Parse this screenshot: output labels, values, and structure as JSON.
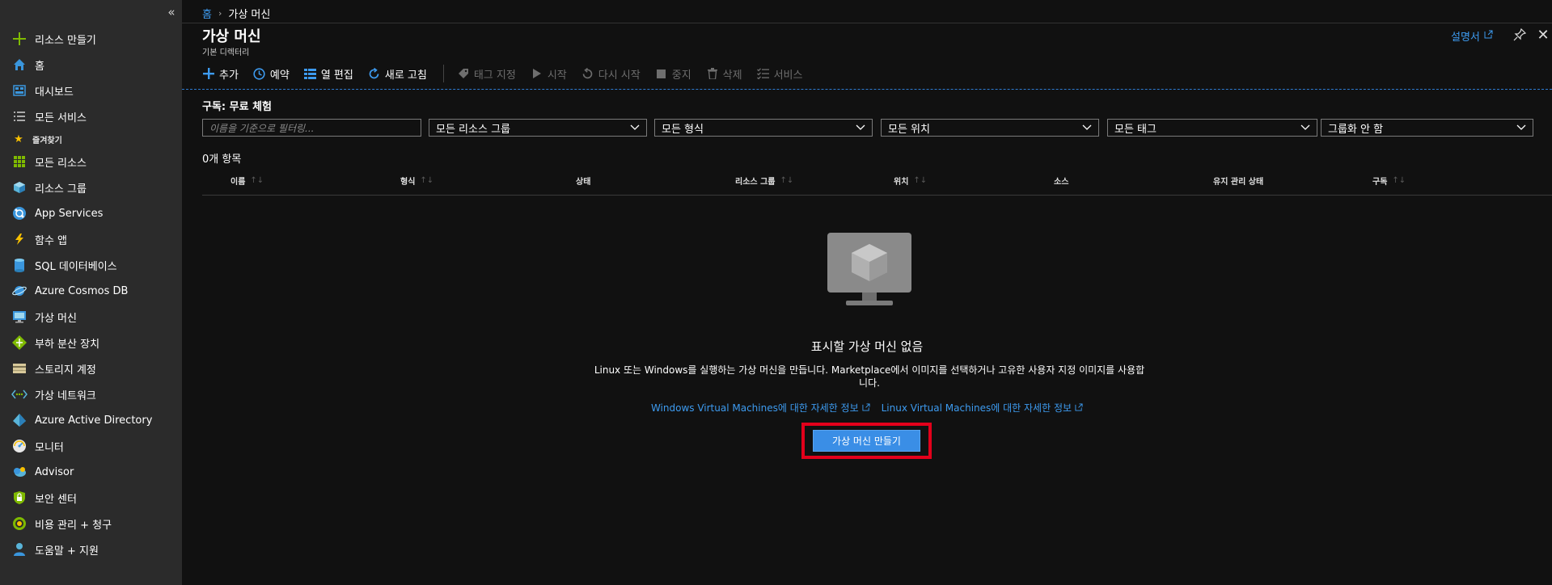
{
  "sidebar": {
    "create_resource": "리소스 만들기",
    "home": "홈",
    "dashboard": "대시보드",
    "all_services": "모든 서비스",
    "favorites": "즐겨찾기",
    "items": [
      {
        "label": "모든 리소스",
        "icon": "all-resources-icon"
      },
      {
        "label": "리소스 그룹",
        "icon": "resource-groups-icon"
      },
      {
        "label": "App Services",
        "icon": "app-services-icon"
      },
      {
        "label": "함수 앱",
        "icon": "function-app-icon"
      },
      {
        "label": "SQL 데이터베이스",
        "icon": "sql-database-icon"
      },
      {
        "label": "Azure Cosmos DB",
        "icon": "cosmos-db-icon"
      },
      {
        "label": "가상 머신",
        "icon": "virtual-machine-icon"
      },
      {
        "label": "부하 분산 장치",
        "icon": "load-balancer-icon"
      },
      {
        "label": "스토리지 계정",
        "icon": "storage-account-icon"
      },
      {
        "label": "가상 네트워크",
        "icon": "virtual-network-icon"
      },
      {
        "label": "Azure Active Directory",
        "icon": "active-directory-icon"
      },
      {
        "label": "모니터",
        "icon": "monitor-icon"
      },
      {
        "label": "Advisor",
        "icon": "advisor-icon"
      },
      {
        "label": "보안 센터",
        "icon": "security-center-icon"
      },
      {
        "label": "비용 관리 + 청구",
        "icon": "cost-management-icon"
      },
      {
        "label": "도움말 + 지원",
        "icon": "help-support-icon"
      }
    ]
  },
  "breadcrumb": {
    "home": "홈",
    "sep": "›",
    "current": "가상 머신"
  },
  "header": {
    "title": "가상 머신",
    "subtitle": "기본 디렉터리",
    "docs": "설명서"
  },
  "toolbar": {
    "add": "추가",
    "schedule": "예약",
    "edit_columns": "열 편집",
    "refresh": "새로 고침",
    "tags": "태그 지정",
    "start": "시작",
    "restart": "다시 시작",
    "stop": "중지",
    "delete": "삭제",
    "services": "서비스"
  },
  "subscription": "구독: 무료 체험",
  "filters": {
    "name_placeholder": "이름을 기준으로 필터링...",
    "resource_group": "모든 리소스 그룹",
    "type": "모든 형식",
    "location": "모든 위치",
    "tags": "모든 태그",
    "grouping": "그룹화 안 함"
  },
  "count": "0개 항목",
  "columns": {
    "name": "이름",
    "type": "형식",
    "status": "상태",
    "resource_group": "리소스 그룹",
    "location": "위치",
    "source": "소스",
    "maintenance": "유지 관리 상태",
    "subscription": "구독",
    "sort": "↑↓"
  },
  "empty": {
    "title": "표시할 가상 머신 없음",
    "desc": "Linux 또는 Windows를 실행하는 가상 머신을 만듭니다. Marketplace에서 이미지를 선택하거나 고유한 사용자 지정 이미지를 사용합니다.",
    "link_windows": "Windows Virtual Machines에 대한 자세한 정보",
    "link_linux": "Linux Virtual Machines에 대한 자세한 정보",
    "create": "가상 머신 만들기"
  }
}
